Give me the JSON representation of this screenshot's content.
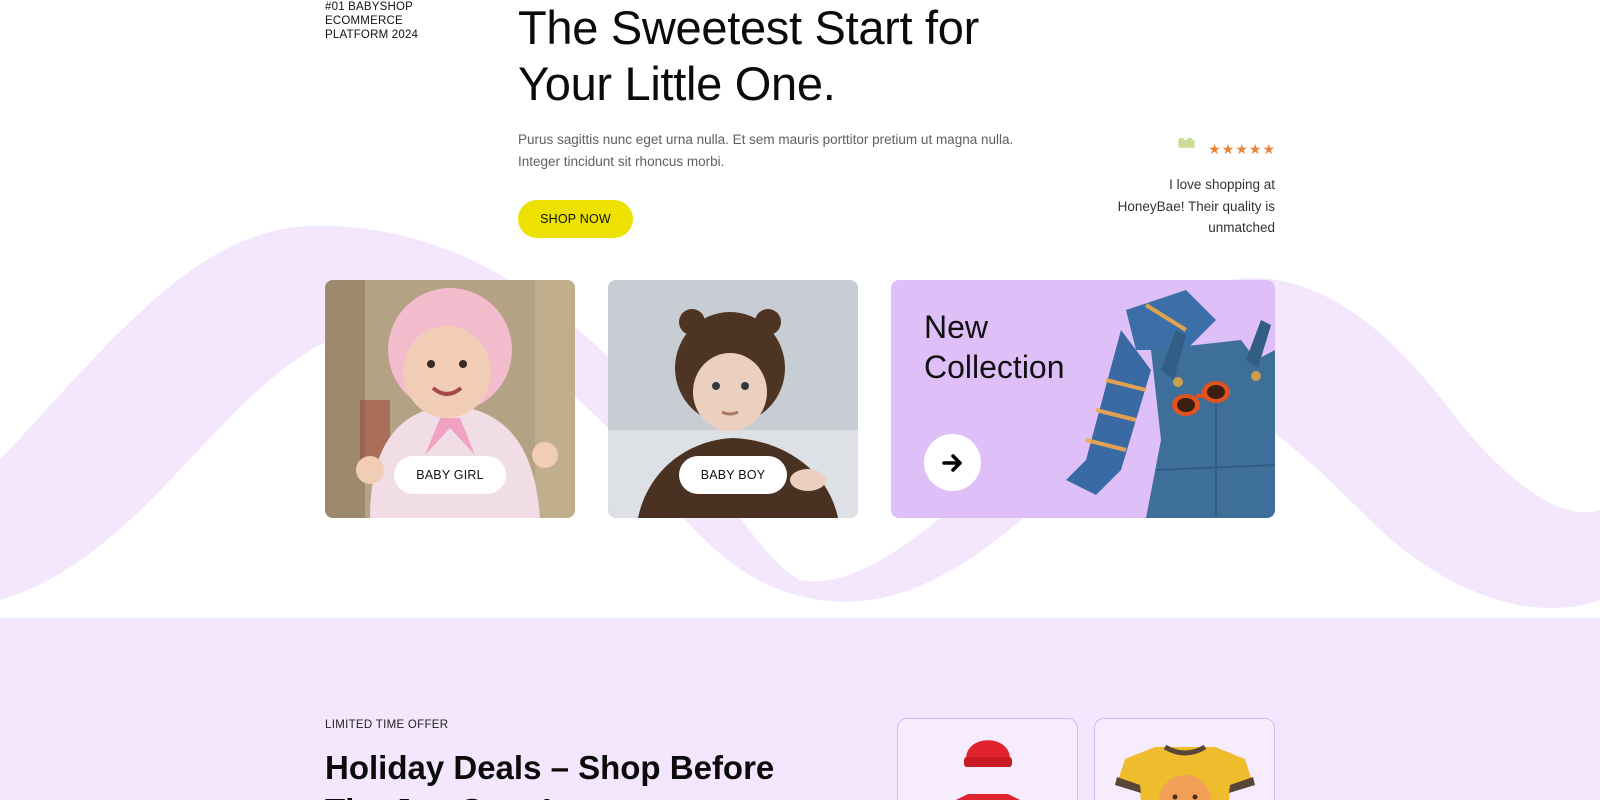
{
  "hero": {
    "eyebrow": "#01 BABYSHOP ECOMMERCE PLATFORM 2024",
    "headline": "The Sweetest Start for Your Little One.",
    "subtext": "Purus sagittis nunc eget urna nulla. Et sem mauris porttitor pretium ut magna nulla. Integer tincidunt sit rhoncus morbi.",
    "shop_now_label": "SHOP NOW"
  },
  "testimonial": {
    "quote_glyph": "❝",
    "rating": 5,
    "text": "I love shopping at HoneyBae! Their quality is unmatched"
  },
  "categories": [
    {
      "label": "BABY GIRL",
      "icon": "baby-girl-photo"
    },
    {
      "label": "BABY BOY",
      "icon": "baby-boy-photo"
    }
  ],
  "new_collection": {
    "title": "New Collection",
    "icon": "arrow-right-icon"
  },
  "deals": {
    "eyebrow": "LIMITED TIME OFFER",
    "title": "Holiday Deals – Shop Before The Joy Goes!",
    "products": [
      {
        "icon": "red-beanie-outfit"
      },
      {
        "icon": "tiger-onesie"
      }
    ]
  },
  "colors": {
    "accent_yellow": "#ece100",
    "lavender": "#dfbff8",
    "wave": "#f3e6fd",
    "star": "#e8843a",
    "quote": "#c9dd92"
  }
}
